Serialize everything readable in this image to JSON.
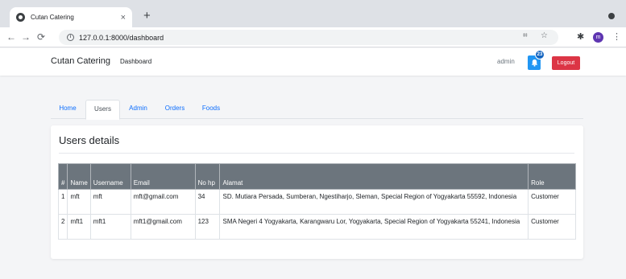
{
  "browser": {
    "tab_title": "Cutan Catering",
    "tab_close": "×",
    "new_tab": "+",
    "url": "127.0.0.1:8000/dashboard",
    "profile_initial": "m"
  },
  "navbar": {
    "brand": "Cutan Catering",
    "dashboard_link": "Dashboard",
    "admin_name": "admin",
    "notification_count": "23",
    "logout_label": "Logout"
  },
  "tabs": [
    "Home",
    "Users",
    "Admin",
    "Orders",
    "Foods"
  ],
  "active_tab": "Users",
  "card": {
    "title": "Users details"
  },
  "table": {
    "headers": {
      "num": "#",
      "name": "Name",
      "username": "Username",
      "email": "Email",
      "nohp": "No hp",
      "alamat": "Alamat",
      "role": "Role"
    },
    "rows": [
      {
        "num": "1",
        "name": "mft",
        "username": "mft",
        "email": "mft@gmail.com",
        "nohp": "34",
        "alamat": "SD. Mutiara Persada, Sumberan, Ngestiharjo, Sleman, Special Region of Yogyakarta 55592, Indonesia",
        "role": "Customer"
      },
      {
        "num": "2",
        "name": "mft1",
        "username": "mft1",
        "email": "mft1@gmail.com",
        "nohp": "123",
        "alamat": "SMA Negeri 4 Yogyakarta, Karangwaru Lor, Yogyakarta, Special Region of Yogyakarta 55241, Indonesia",
        "role": "Customer"
      }
    ]
  },
  "colors": {
    "notification": "#2196f3",
    "logout": "#dc3545",
    "table_header": "#6c757d",
    "link": "#0d6efd"
  }
}
